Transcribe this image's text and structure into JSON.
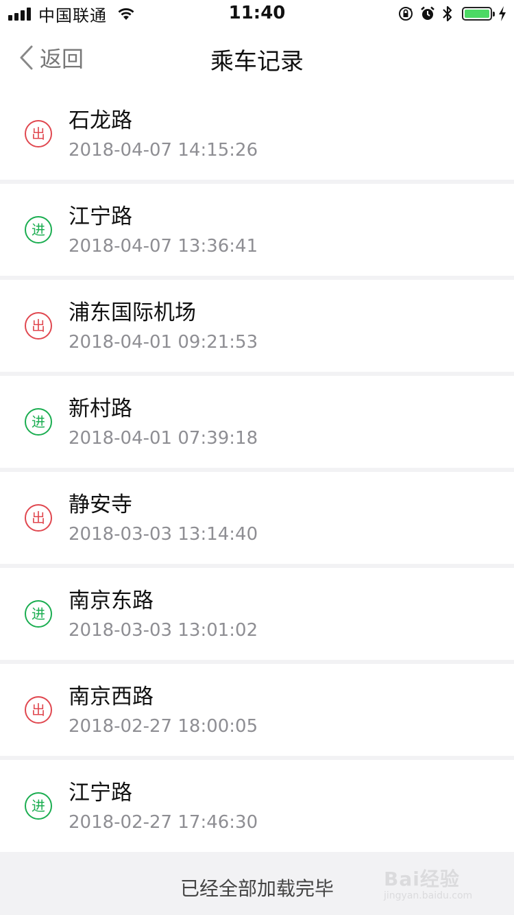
{
  "status_bar": {
    "carrier": "中国联通",
    "time": "11:40",
    "battery_level": 1.0,
    "colors": {
      "battery": "#4cd964"
    },
    "icons": [
      "signal-icon",
      "wifi-icon",
      "orientation-lock-icon",
      "alarm-icon",
      "bluetooth-icon",
      "battery-icon",
      "charging-icon"
    ]
  },
  "nav": {
    "back_label": "返回",
    "title": "乘车记录"
  },
  "records": [
    {
      "type": "out",
      "badge": "出",
      "station": "石龙路",
      "time": "2018-04-07 14:15:26"
    },
    {
      "type": "in",
      "badge": "进",
      "station": "江宁路",
      "time": "2018-04-07 13:36:41"
    },
    {
      "type": "out",
      "badge": "出",
      "station": "浦东国际机场",
      "time": "2018-04-01 09:21:53"
    },
    {
      "type": "in",
      "badge": "进",
      "station": "新村路",
      "time": "2018-04-01 07:39:18"
    },
    {
      "type": "out",
      "badge": "出",
      "station": "静安寺",
      "time": "2018-03-03 13:14:40"
    },
    {
      "type": "in",
      "badge": "进",
      "station": "南京东路",
      "time": "2018-03-03 13:01:02"
    },
    {
      "type": "out",
      "badge": "出",
      "station": "南京西路",
      "time": "2018-02-27 18:00:05"
    },
    {
      "type": "in",
      "badge": "进",
      "station": "江宁路",
      "time": "2018-02-27 17:46:30"
    }
  ],
  "colors": {
    "out": "#e0474f",
    "in": "#1aad50"
  },
  "footer": {
    "text": "已经全部加载完毕"
  },
  "watermark": {
    "main": "Bai经验",
    "sub": "jingyan.baidu.com"
  }
}
